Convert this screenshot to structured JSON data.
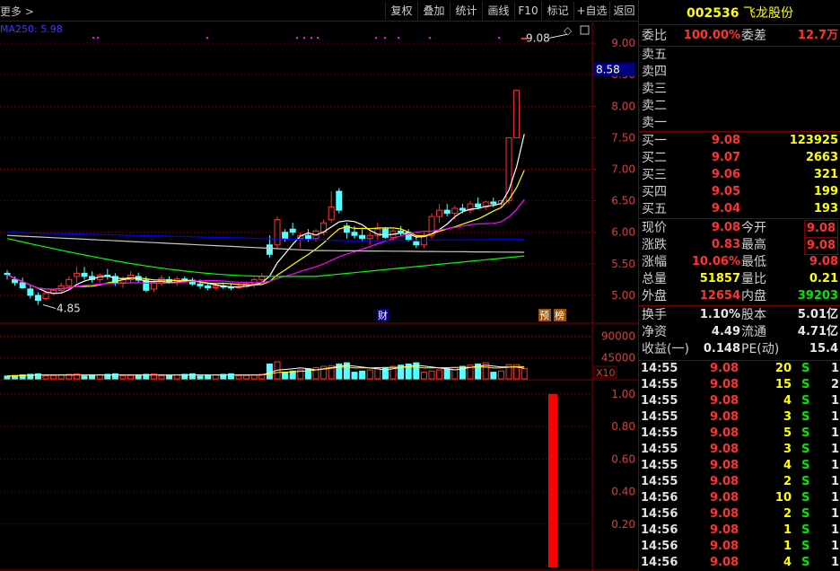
{
  "toolbar": {
    "more_label": "更多 >",
    "buttons": [
      "复权",
      "叠加",
      "统计",
      "画线",
      "F10",
      "标记",
      "+自选",
      "返回"
    ]
  },
  "main_chart": {
    "ma_label": "MA250: 5.98",
    "price_ticks": [
      "9.00",
      "8.50",
      "8.00",
      "7.50",
      "7.00",
      "6.50",
      "6.00",
      "5.50",
      "5.00"
    ],
    "current_price_tag": "8.58",
    "high_annotation": "9.08",
    "low_annotation": "4.85",
    "markers": [
      "财",
      "预",
      "榜"
    ]
  },
  "volume_chart": {
    "ticks": [
      "90000",
      "45000"
    ],
    "unit": "X10"
  },
  "indicator_chart": {
    "ticks": [
      "1.00",
      "0.80",
      "0.60",
      "0.40",
      "0.20"
    ]
  },
  "stock": {
    "code": "002536",
    "name": "飞龙股份"
  },
  "order_book": {
    "weibi_label": "委比",
    "weibi_value": "100.00%",
    "weicha_label": "委差",
    "weicha_value": "12.7万",
    "asks": [
      {
        "label": "卖五"
      },
      {
        "label": "卖四"
      },
      {
        "label": "卖三"
      },
      {
        "label": "卖二"
      },
      {
        "label": "卖一"
      }
    ],
    "bids": [
      {
        "label": "买一",
        "price": "9.08",
        "volume": "123925"
      },
      {
        "label": "买二",
        "price": "9.07",
        "volume": "2663"
      },
      {
        "label": "买三",
        "price": "9.06",
        "volume": "321"
      },
      {
        "label": "买四",
        "price": "9.05",
        "volume": "199"
      },
      {
        "label": "买五",
        "price": "9.04",
        "volume": "193"
      }
    ]
  },
  "quote": [
    {
      "l1": "现价",
      "v1": "9.08",
      "c1": "red",
      "l2": "今开",
      "v2": "9.08",
      "c2": "red",
      "boxed": true
    },
    {
      "l1": "涨跌",
      "v1": "0.83",
      "c1": "red",
      "l2": "最高",
      "v2": "9.08",
      "c2": "red",
      "boxed": true
    },
    {
      "l1": "涨幅",
      "v1": "10.06%",
      "c1": "red",
      "l2": "最低",
      "v2": "9.08",
      "c2": "red"
    },
    {
      "l1": "总量",
      "v1": "51857",
      "c1": "yellow",
      "l2": "量比",
      "v2": "0.21",
      "c2": "yellow"
    },
    {
      "l1": "外盘",
      "v1": "12654",
      "c1": "red",
      "l2": "内盘",
      "v2": "39203",
      "c2": "green"
    }
  ],
  "stats": [
    {
      "l1": "换手",
      "v1": "1.10%",
      "l2": "股本",
      "v2": "5.01亿"
    },
    {
      "l1": "净资",
      "v1": "4.49",
      "l2": "流通",
      "v2": "4.71亿"
    },
    {
      "l1": "收益(一)",
      "v1": "0.148",
      "l2": "PE(动)",
      "v2": "15.4"
    }
  ],
  "ticks": [
    {
      "time": "14:55",
      "price": "9.08",
      "vol": "20",
      "side": "S",
      "num": "1"
    },
    {
      "time": "14:55",
      "price": "9.08",
      "vol": "15",
      "side": "S",
      "num": "2"
    },
    {
      "time": "14:55",
      "price": "9.08",
      "vol": "4",
      "side": "S",
      "num": "1"
    },
    {
      "time": "14:55",
      "price": "9.08",
      "vol": "3",
      "side": "S",
      "num": "1"
    },
    {
      "time": "14:55",
      "price": "9.08",
      "vol": "5",
      "side": "S",
      "num": "1"
    },
    {
      "time": "14:55",
      "price": "9.08",
      "vol": "3",
      "side": "S",
      "num": "1"
    },
    {
      "time": "14:55",
      "price": "9.08",
      "vol": "4",
      "side": "S",
      "num": "1"
    },
    {
      "time": "14:55",
      "price": "9.08",
      "vol": "2",
      "side": "S",
      "num": "1"
    },
    {
      "time": "14:56",
      "price": "9.08",
      "vol": "10",
      "side": "S",
      "num": "1"
    },
    {
      "time": "14:56",
      "price": "9.08",
      "vol": "2",
      "side": "S",
      "num": "1"
    },
    {
      "time": "14:56",
      "price": "9.08",
      "vol": "1",
      "side": "S",
      "num": "1"
    },
    {
      "time": "14:56",
      "price": "9.08",
      "vol": "1",
      "side": "S",
      "num": "1"
    },
    {
      "time": "14:56",
      "price": "9.08",
      "vol": "4",
      "side": "S",
      "num": "1"
    }
  ],
  "colors": {
    "up": "#ff3232",
    "down": "#54ffff",
    "grid": "#800000",
    "ma5": "#ffffff",
    "ma10": "#ffff00",
    "ma20": "#ff00ff",
    "ma60": "#00ff00",
    "ma250": "#0000ff"
  },
  "chart_data": {
    "type": "candlestick",
    "price_axis": {
      "min": 4.7,
      "max": 9.2,
      "ticks": [
        5.0,
        5.5,
        6.0,
        6.5,
        7.0,
        7.5,
        8.0,
        8.5,
        9.0
      ]
    },
    "candles": [
      [
        5.35,
        5.4,
        5.25,
        5.33
      ],
      [
        5.25,
        5.3,
        5.15,
        5.2
      ],
      [
        5.2,
        5.28,
        5.1,
        5.12
      ],
      [
        5.1,
        5.15,
        4.95,
        5.0
      ],
      [
        5.0,
        5.05,
        4.85,
        4.92
      ],
      [
        4.95,
        5.05,
        4.92,
        5.03
      ],
      [
        5.03,
        5.1,
        5.0,
        5.08
      ],
      [
        5.08,
        5.2,
        5.05,
        5.15
      ],
      [
        5.15,
        5.3,
        5.1,
        5.25
      ],
      [
        5.3,
        5.45,
        5.2,
        5.35
      ],
      [
        5.35,
        5.45,
        5.25,
        5.3
      ],
      [
        5.3,
        5.38,
        5.2,
        5.25
      ],
      [
        5.25,
        5.35,
        5.2,
        5.32
      ],
      [
        5.32,
        5.42,
        5.25,
        5.3
      ],
      [
        5.3,
        5.35,
        5.15,
        5.2
      ],
      [
        5.2,
        5.3,
        5.12,
        5.25
      ],
      [
        5.25,
        5.38,
        5.2,
        5.32
      ],
      [
        5.3,
        5.36,
        5.2,
        5.24
      ],
      [
        5.24,
        5.3,
        5.05,
        5.08
      ],
      [
        5.1,
        5.25,
        5.05,
        5.2
      ],
      [
        5.2,
        5.32,
        5.15,
        5.27
      ],
      [
        5.25,
        5.3,
        5.18,
        5.22
      ],
      [
        5.22,
        5.3,
        5.15,
        5.26
      ],
      [
        5.26,
        5.3,
        5.2,
        5.24
      ],
      [
        5.24,
        5.28,
        5.15,
        5.18
      ],
      [
        5.18,
        5.25,
        5.1,
        5.15
      ],
      [
        5.15,
        5.2,
        5.08,
        5.12
      ],
      [
        5.12,
        5.18,
        5.08,
        5.15
      ],
      [
        5.15,
        5.2,
        5.1,
        5.13
      ],
      [
        5.13,
        5.18,
        5.08,
        5.12
      ],
      [
        5.12,
        5.2,
        5.1,
        5.14
      ],
      [
        5.14,
        5.22,
        5.12,
        5.18
      ],
      [
        5.18,
        5.28,
        5.12,
        5.25
      ],
      [
        5.25,
        5.35,
        5.2,
        5.3
      ],
      [
        5.8,
        5.95,
        5.6,
        5.65
      ],
      [
        5.8,
        6.25,
        5.75,
        6.2
      ],
      [
        6.0,
        6.05,
        5.85,
        5.9
      ],
      [
        6.05,
        6.15,
        5.95,
        6.0
      ],
      [
        5.9,
        6.0,
        5.75,
        5.95
      ],
      [
        5.95,
        6.05,
        5.85,
        5.9
      ],
      [
        5.9,
        6.05,
        5.85,
        6.02
      ],
      [
        6.0,
        6.2,
        5.95,
        6.15
      ],
      [
        6.2,
        6.65,
        6.15,
        6.4
      ],
      [
        6.65,
        6.7,
        6.3,
        6.35
      ],
      [
        6.1,
        6.15,
        5.9,
        6.0
      ],
      [
        6.0,
        6.1,
        5.9,
        5.95
      ],
      [
        5.95,
        6.05,
        5.85,
        5.9
      ],
      [
        5.9,
        6.0,
        5.8,
        5.95
      ],
      [
        5.95,
        6.15,
        5.88,
        6.05
      ],
      [
        6.05,
        6.08,
        5.9,
        5.92
      ],
      [
        5.92,
        6.05,
        5.88,
        6.02
      ],
      [
        6.02,
        6.1,
        5.95,
        6.0
      ],
      [
        6.0,
        6.05,
        5.85,
        5.88
      ],
      [
        5.85,
        5.95,
        5.75,
        5.8
      ],
      [
        5.8,
        6.0,
        5.75,
        5.95
      ],
      [
        5.95,
        6.3,
        5.9,
        6.25
      ],
      [
        6.25,
        6.45,
        6.15,
        6.35
      ],
      [
        6.35,
        6.45,
        6.25,
        6.3
      ],
      [
        6.3,
        6.42,
        6.2,
        6.38
      ],
      [
        6.38,
        6.45,
        6.3,
        6.35
      ],
      [
        6.35,
        6.5,
        6.3,
        6.45
      ],
      [
        6.45,
        6.55,
        6.38,
        6.4
      ],
      [
        6.4,
        6.5,
        6.35,
        6.48
      ],
      [
        6.48,
        6.55,
        6.4,
        6.45
      ],
      [
        6.45,
        6.52,
        6.4,
        6.5
      ],
      [
        6.5,
        7.5,
        6.45,
        7.5
      ],
      [
        7.5,
        8.25,
        7.5,
        8.25
      ],
      [
        9.08,
        9.08,
        9.08,
        9.08
      ]
    ],
    "volume_axis": {
      "max": 90000,
      "ticks": [
        45000,
        90000
      ]
    },
    "indicator_axis": {
      "max": 1.0,
      "ticks": [
        0.2,
        0.4,
        0.6,
        0.8,
        1.0
      ],
      "last_value": 1.0
    }
  }
}
